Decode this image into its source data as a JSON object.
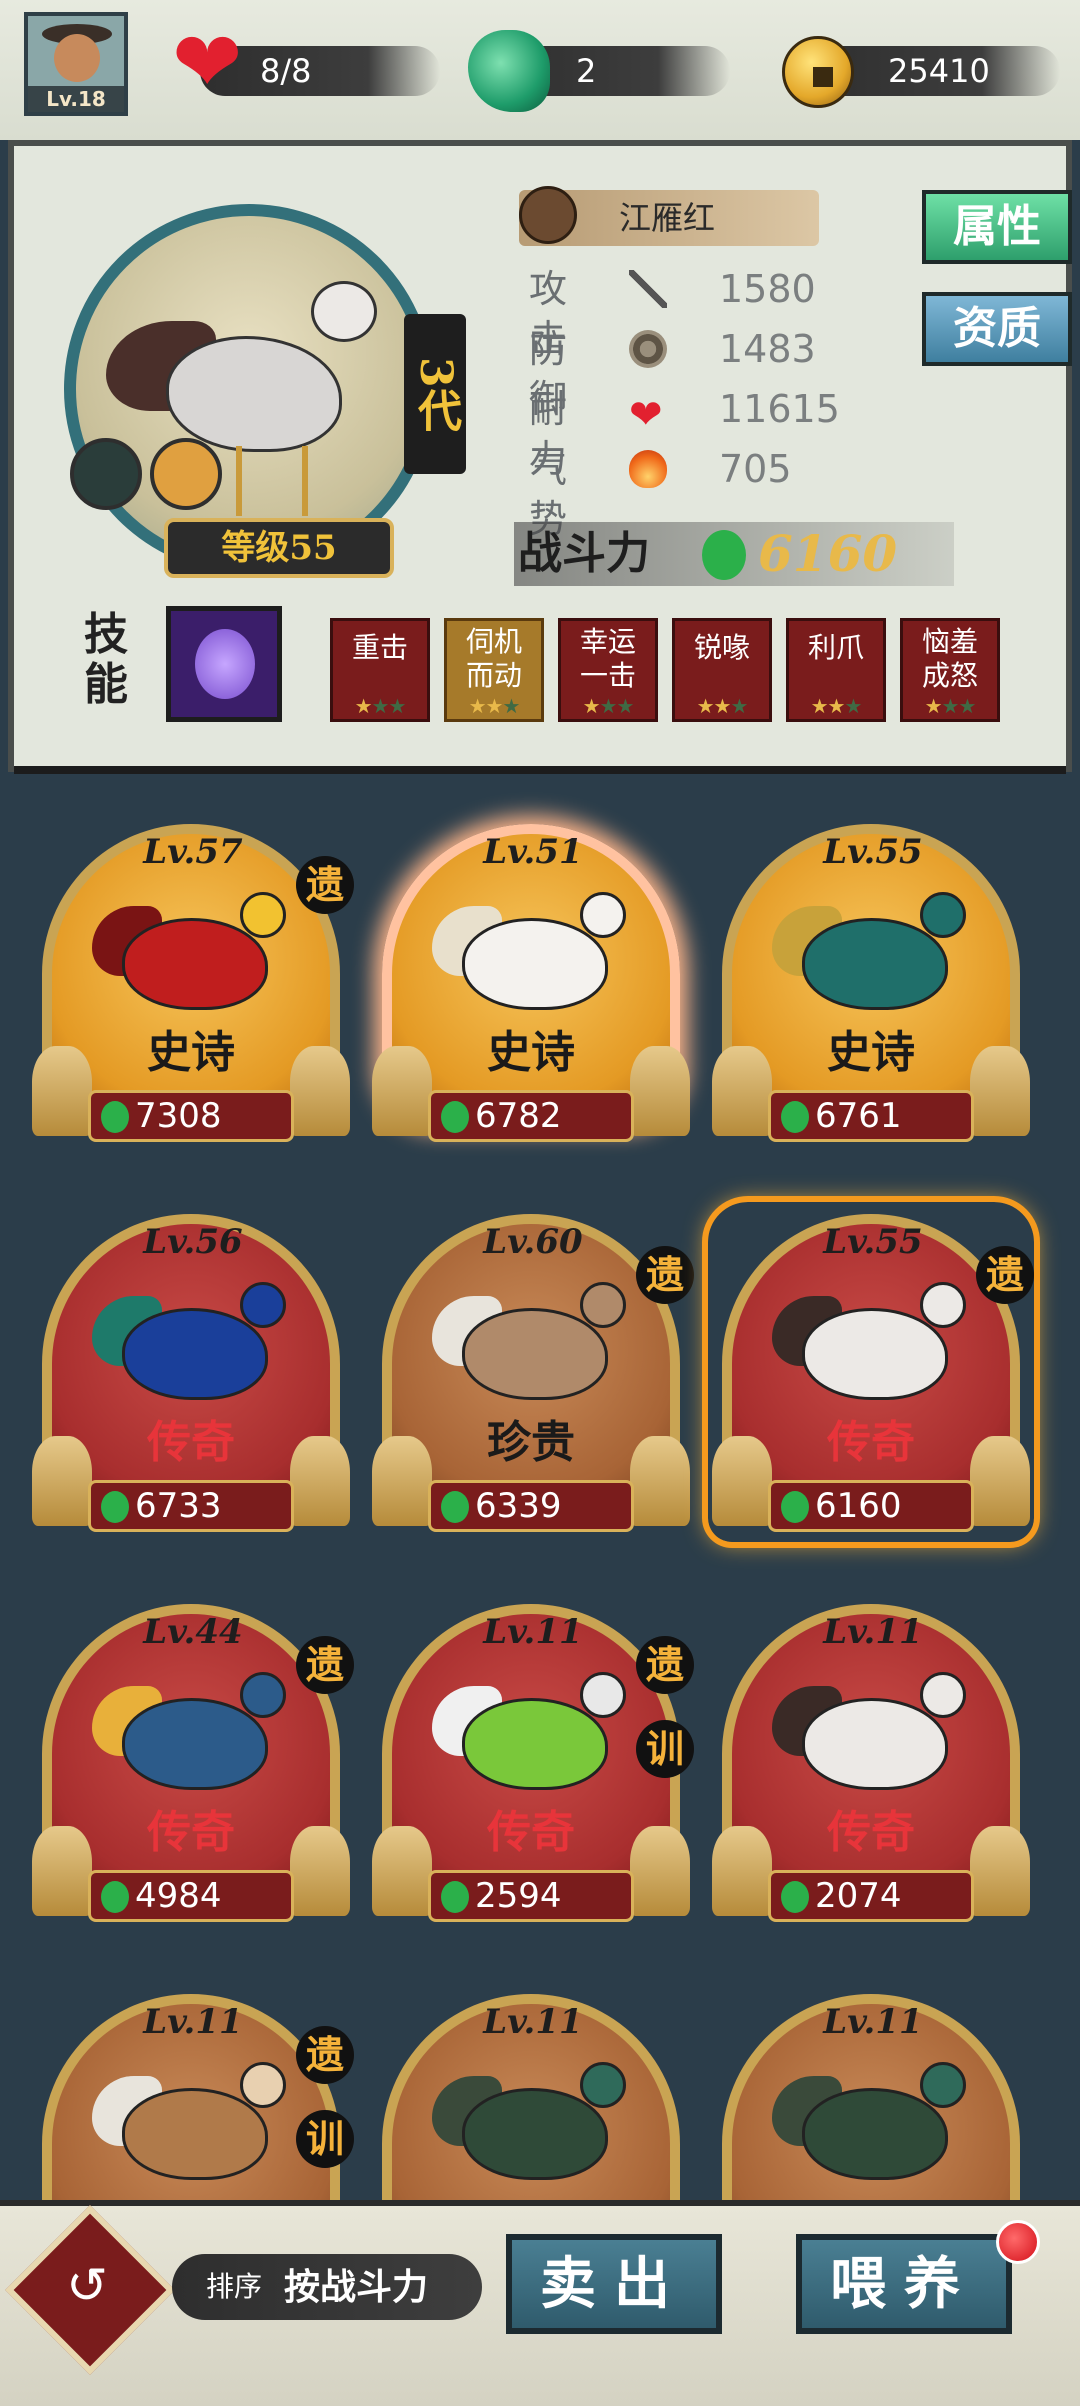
{
  "player": {
    "level": "Lv.18"
  },
  "resources": {
    "stamina": {
      "icon": "heart-icon",
      "value": "8/8"
    },
    "jade": {
      "icon": "jade-dragon-icon",
      "value": "2"
    },
    "coins": {
      "icon": "coin-icon",
      "value": "25410"
    }
  },
  "detail": {
    "name": "江雁红",
    "generation": "3代",
    "level_plate": "等级55",
    "stats": [
      {
        "label": "攻击",
        "icon": "sword-icon",
        "value": "1580"
      },
      {
        "label": "防御",
        "icon": "shield-icon",
        "value": "1483"
      },
      {
        "label": "耐力",
        "icon": "heart-icon",
        "value": "11615"
      },
      {
        "label": "气势",
        "icon": "fire-icon",
        "value": "705"
      }
    ],
    "power_label": "战斗力",
    "power_value": "6160",
    "tabs": [
      "属性",
      "资质"
    ],
    "skills_label": "技能",
    "skills": [
      {
        "name": "重击",
        "stars": 1,
        "style": "red"
      },
      {
        "name": "伺机而动",
        "stars": 2,
        "style": "gold"
      },
      {
        "name": "幸运一击",
        "stars": 1,
        "style": "red"
      },
      {
        "name": "锐喙",
        "stars": 2,
        "style": "red"
      },
      {
        "name": "利爪",
        "stars": 2,
        "style": "red"
      },
      {
        "name": "恼羞成怒",
        "stars": 1,
        "style": "red"
      }
    ]
  },
  "cards": [
    {
      "level": "Lv.57",
      "rarity": "史诗",
      "power": "7308",
      "tags": [
        "遗"
      ],
      "tier": "epic"
    },
    {
      "level": "Lv.51",
      "rarity": "史诗",
      "power": "6782",
      "tags": [],
      "tier": "epic"
    },
    {
      "level": "Lv.55",
      "rarity": "史诗",
      "power": "6761",
      "tags": [],
      "tier": "epic"
    },
    {
      "level": "Lv.56",
      "rarity": "传奇",
      "power": "6733",
      "tags": [],
      "tier": "legend"
    },
    {
      "level": "Lv.60",
      "rarity": "珍贵",
      "power": "6339",
      "tags": [
        "遗"
      ],
      "tier": "rare"
    },
    {
      "level": "Lv.55",
      "rarity": "传奇",
      "power": "6160",
      "tags": [
        "遗"
      ],
      "tier": "legend",
      "selected": true
    },
    {
      "level": "Lv.44",
      "rarity": "传奇",
      "power": "4984",
      "tags": [
        "遗"
      ],
      "tier": "legend"
    },
    {
      "level": "Lv.11",
      "rarity": "传奇",
      "power": "2594",
      "tags": [
        "遗",
        "训"
      ],
      "tier": "legend"
    },
    {
      "level": "Lv.11",
      "rarity": "传奇",
      "power": "2074",
      "tags": [],
      "tier": "legend"
    },
    {
      "level": "Lv.11",
      "rarity": "",
      "power": "",
      "tags": [
        "遗",
        "训"
      ],
      "tier": "rare"
    },
    {
      "level": "Lv.11",
      "rarity": "",
      "power": "",
      "tags": [],
      "tier": "rare"
    },
    {
      "level": "Lv.11",
      "rarity": "",
      "power": "",
      "tags": [],
      "tier": "rare"
    }
  ],
  "bottom": {
    "sort_label": "排序",
    "sort_value": "按战斗力",
    "sell": "卖出",
    "feed": "喂养"
  },
  "colors": {
    "epic": "#e49a24",
    "legend": "#a82e2e",
    "selected_glow": "#f59a1e",
    "power_gold": "#e8b94a"
  }
}
